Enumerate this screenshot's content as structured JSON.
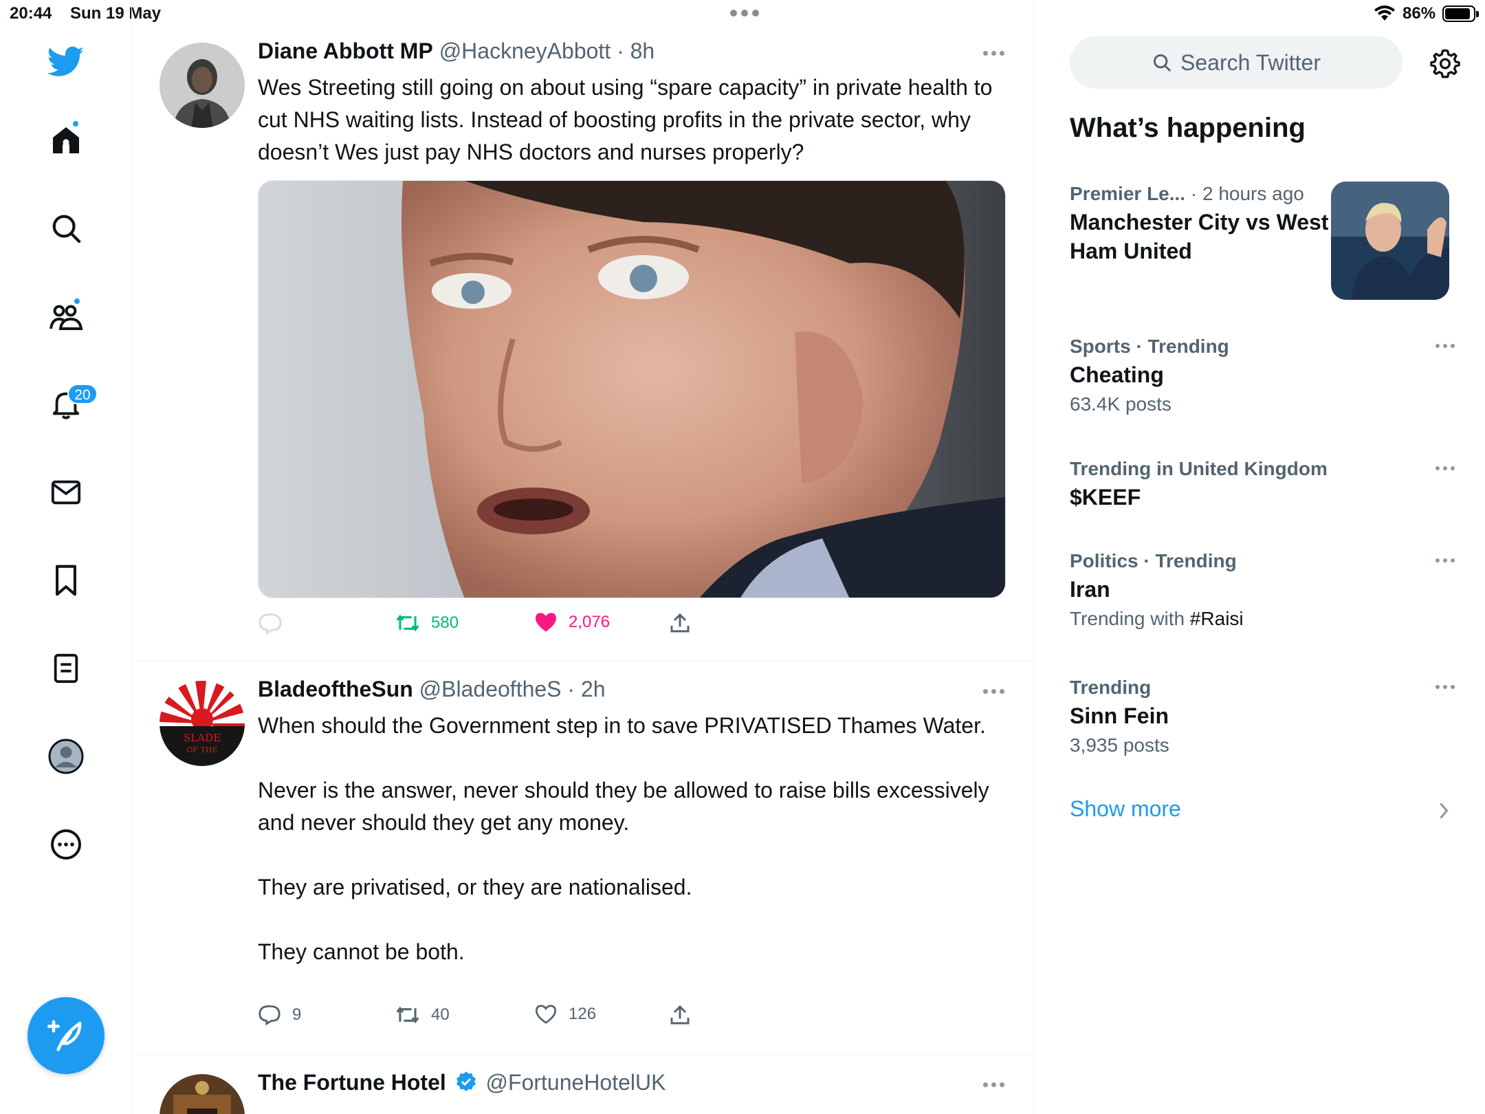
{
  "status_bar": {
    "time": "20:44",
    "date": "Sun 19 May",
    "battery": "86%"
  },
  "colors": {
    "accent": "#1d9bf0",
    "retweet_active": "#00ba7c",
    "like_active": "#f91880",
    "muted": "#536471"
  },
  "nav": {
    "items": [
      {
        "name": "logo",
        "icon": "twitter-bird-icon"
      },
      {
        "name": "home",
        "icon": "home-icon"
      },
      {
        "name": "explore",
        "icon": "search-icon"
      },
      {
        "name": "communities",
        "icon": "people-icon"
      },
      {
        "name": "notifications",
        "icon": "bell-icon"
      },
      {
        "name": "messages",
        "icon": "mail-icon"
      },
      {
        "name": "bookmarks",
        "icon": "bookmark-icon"
      },
      {
        "name": "lists",
        "icon": "list-icon"
      },
      {
        "name": "profile",
        "icon": "profile-icon"
      },
      {
        "name": "more",
        "icon": "more-icon"
      }
    ],
    "notifications_count": "20"
  },
  "feed": {
    "tweets": [
      {
        "name": "Diane Abbott MP",
        "handle": "@HackneyAbbott",
        "time": "· 8h",
        "text": "Wes Streeting still going on about using “spare capacity” in private health to cut NHS waiting lists. Instead of boosting profits in the private sector, why doesn’t Wes just pay NHS doctors and nurses properly?",
        "retweets": "580",
        "likes": "2,076"
      },
      {
        "name": "BladeoftheSun",
        "handle": "@BladeoftheS",
        "time": "· 2h",
        "text": "When should the Government step in to save PRIVATISED Thames Water.\n\nNever is the answer, never should they be allowed to raise bills excessively and never should they get any money.\n\nThey are privatised, or they are nationalised.\n\nThey cannot be both.",
        "replies": "9",
        "retweets": "40",
        "likes": "126"
      },
      {
        "name": "The Fortune Hotel",
        "handle": "@FortuneHotelUK"
      }
    ]
  },
  "sidebar": {
    "search_placeholder": "Search Twitter",
    "title": "What’s happening",
    "trends": [
      {
        "category": "Premier Le...",
        "time": "· 2 hours ago",
        "title": "Manchester City vs West Ham United"
      },
      {
        "category": "Sports · Trending",
        "title": "Cheating",
        "sub": "63.4K posts"
      },
      {
        "category": "Trending in United Kingdom",
        "title": "$KEEF"
      },
      {
        "category": "Politics · Trending",
        "title": "Iran",
        "sub_prefix": "Trending with ",
        "sub_tag": "#Raisi"
      },
      {
        "category": "Trending",
        "title": "Sinn Fein",
        "sub": "3,935 posts"
      }
    ],
    "show_more": "Show more"
  }
}
